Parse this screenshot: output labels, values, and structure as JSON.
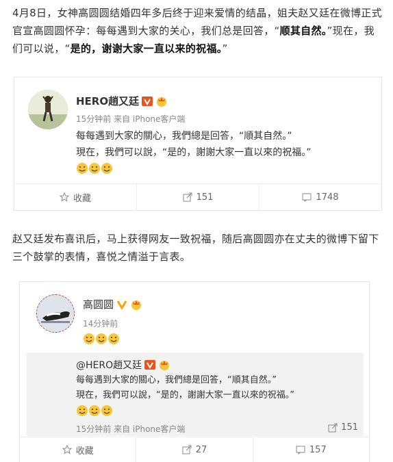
{
  "article": {
    "p1_a": "4月8日，女神高圆圆结婚四年多后终于迎来爱情的结晶，姐夫赵又廷在微博正式官宣高圆圆怀孕：每每遇到大家的关心，我们总是回答，“",
    "p1_b": "顺其自然。",
    "p1_c": "”现在，我们可以说，“",
    "p1_d": "是的，谢谢大家一直以来的祝福。",
    "p1_e": "”",
    "p2": "赵又廷发布喜讯后，马上获得网友一致祝福，随后高圆圆亦在丈夫的微博下留下三个鼓掌的表情，喜悦之情溢于言表。"
  },
  "post1": {
    "username": "HERO趙又廷",
    "meta": "15分钟前 来自 iPhone客户端",
    "line1": "每每遇到大家的關心，我們總是回答，“順其自然。”",
    "line2": "現在，我們可以說，“是的，謝謝大家一直以來的祝福。”",
    "actions": {
      "collect": "收藏",
      "repost": "151",
      "comment": "1748"
    }
  },
  "post2": {
    "username": "高圆圆",
    "meta": "14分钟前",
    "quote": {
      "username": "@HERO趙又廷",
      "line1": "每每遇到大家的關心，我們總是回答，“順其自然。”",
      "line2": "現在，我們可以說，“是的，謝謝大家一直以來的祝福。”",
      "meta": "15分钟前 来自 iPhone客户端",
      "repost": "151"
    },
    "actions": {
      "collect": "收藏",
      "repost": "27",
      "comment": "157"
    }
  },
  "colors": {
    "verified_badge": "#f5a300",
    "emoji": "#f7c536",
    "border": "#e6e6e6"
  }
}
